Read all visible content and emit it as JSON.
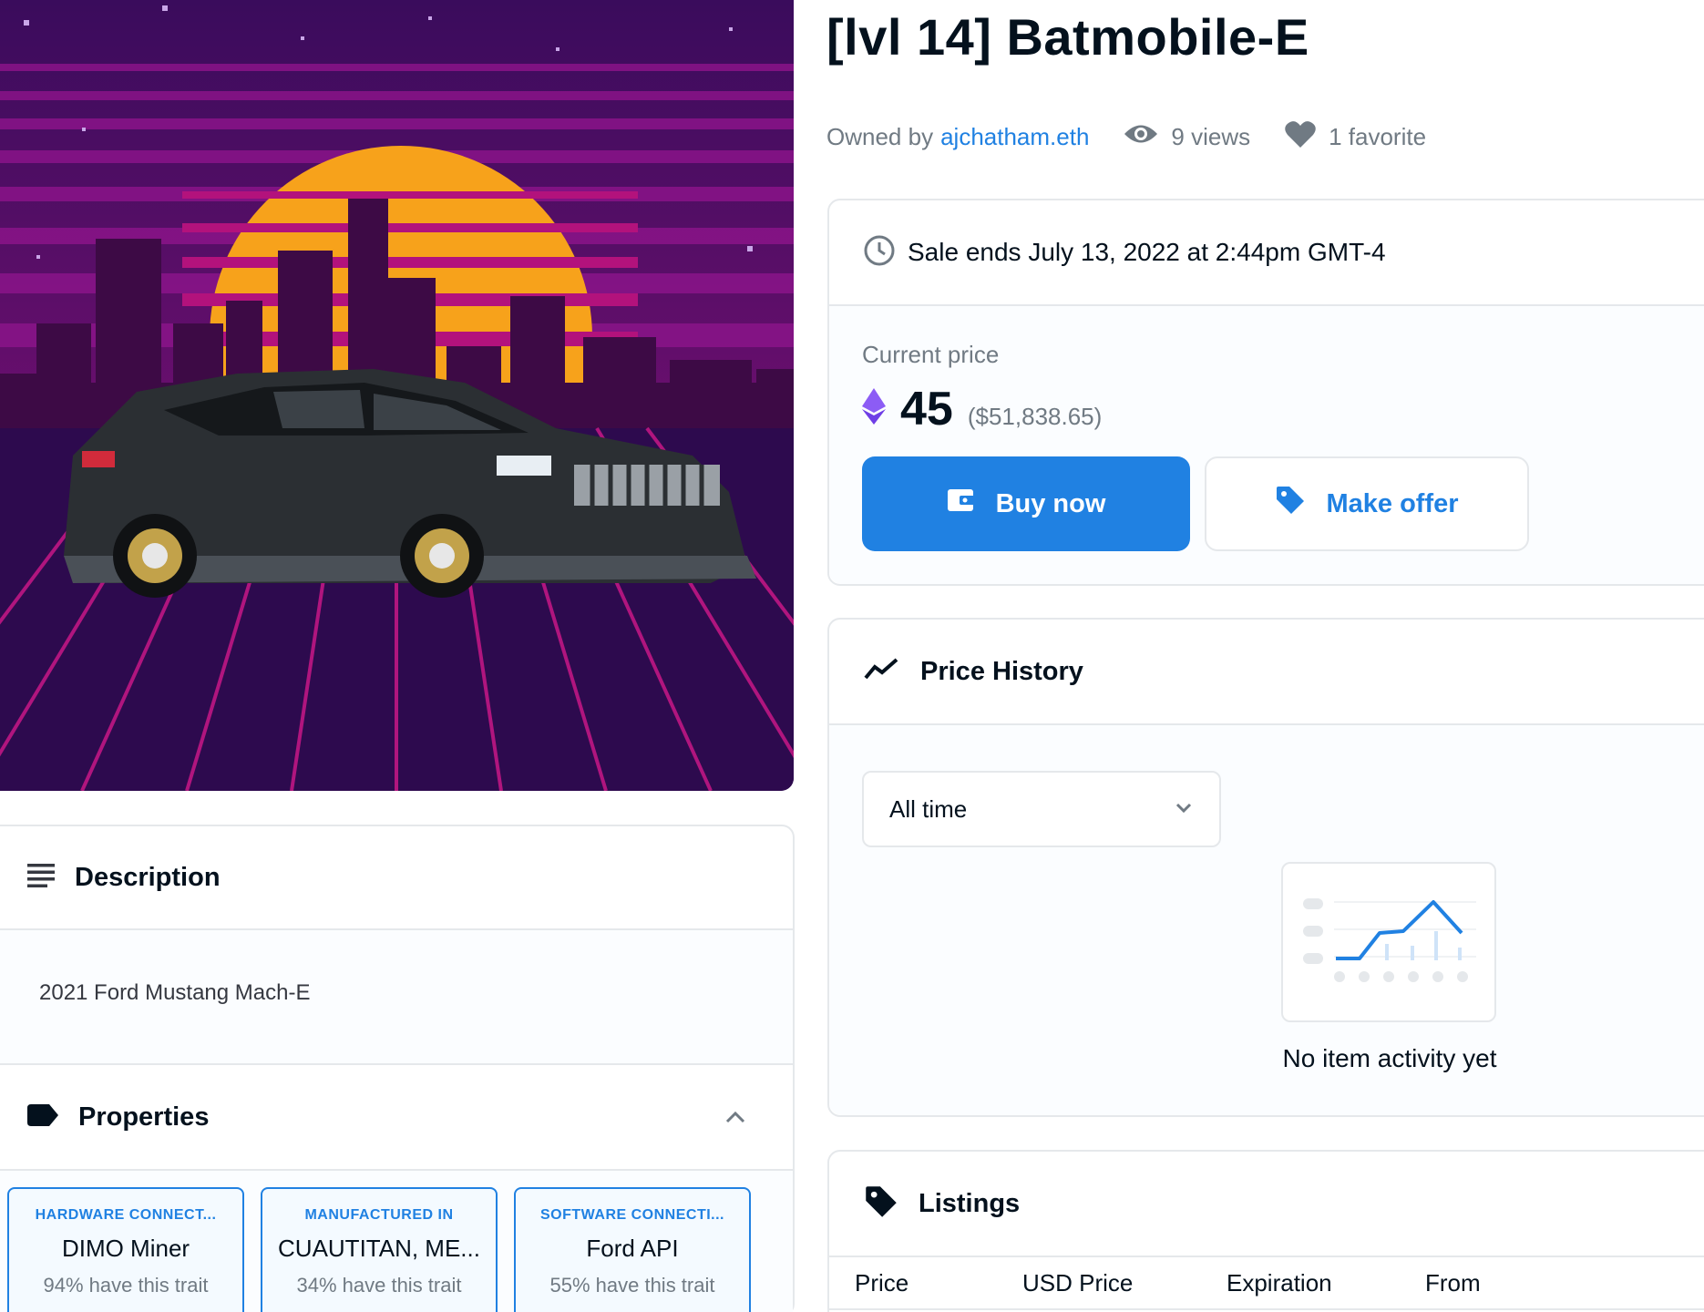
{
  "item": {
    "title": "[lvl 14] Batmobile-E",
    "owned_by_label": "Owned by",
    "owner": "ajchatham.eth",
    "views": "9 views",
    "favorites": "1 favorite"
  },
  "sale": {
    "ends": "Sale ends July 13, 2022 at 2:44pm GMT-4",
    "current_price_label": "Current price",
    "price_eth": "45",
    "price_usd": "($51,838.65)",
    "buy_label": "Buy now",
    "offer_label": "Make offer"
  },
  "price_history": {
    "title": "Price History",
    "range_selected": "All time",
    "empty_text": "No item activity yet"
  },
  "listings": {
    "title": "Listings",
    "columns": [
      "Price",
      "USD Price",
      "Expiration",
      "From"
    ]
  },
  "description": {
    "title": "Description",
    "text": "2021 Ford Mustang Mach-E"
  },
  "properties": {
    "title": "Properties",
    "traits": [
      {
        "type": "HARDWARE CONNECT...",
        "value": "DIMO Miner",
        "rarity": "94% have this trait"
      },
      {
        "type": "MANUFACTURED IN",
        "value": "CUAUTITAN, ME...",
        "rarity": "34% have this trait"
      },
      {
        "type": "SOFTWARE CONNECTI...",
        "value": "Ford API",
        "rarity": "55% have this trait"
      }
    ]
  },
  "colors": {
    "accent": "#2081e2",
    "text": "#04111d",
    "muted": "#707a83",
    "border": "#e5e8eb",
    "eth": "#6f3ee6"
  },
  "icons": {
    "views": "eye-icon",
    "favorites": "heart-icon",
    "sale_ends": "clock-icon",
    "eth": "ethereum-icon",
    "buy": "wallet-icon",
    "offer": "tag-icon",
    "price_history": "trend-line-icon",
    "listings": "tag-icon",
    "description": "lines-icon",
    "properties": "label-icon"
  }
}
